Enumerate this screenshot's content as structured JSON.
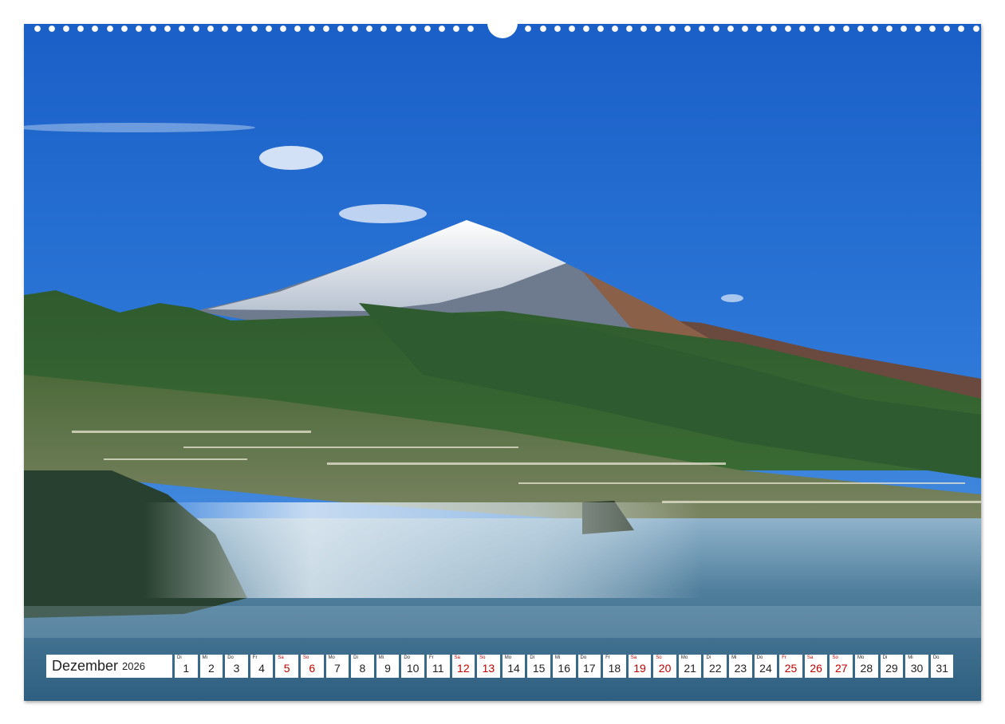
{
  "calendar": {
    "month": "Dezember",
    "year": "2026",
    "days": [
      {
        "wd": "Di",
        "num": "1",
        "red": false
      },
      {
        "wd": "Mi",
        "num": "2",
        "red": false
      },
      {
        "wd": "Do",
        "num": "3",
        "red": false
      },
      {
        "wd": "Fr",
        "num": "4",
        "red": false
      },
      {
        "wd": "Sa",
        "num": "5",
        "red": true
      },
      {
        "wd": "So",
        "num": "6",
        "red": true
      },
      {
        "wd": "Mo",
        "num": "7",
        "red": false
      },
      {
        "wd": "Di",
        "num": "8",
        "red": false
      },
      {
        "wd": "Mi",
        "num": "9",
        "red": false
      },
      {
        "wd": "Do",
        "num": "10",
        "red": false
      },
      {
        "wd": "Fr",
        "num": "11",
        "red": false
      },
      {
        "wd": "Sa",
        "num": "12",
        "red": true
      },
      {
        "wd": "So",
        "num": "13",
        "red": true
      },
      {
        "wd": "Mo",
        "num": "14",
        "red": false
      },
      {
        "wd": "Di",
        "num": "15",
        "red": false
      },
      {
        "wd": "Mi",
        "num": "16",
        "red": false
      },
      {
        "wd": "Do",
        "num": "17",
        "red": false
      },
      {
        "wd": "Fr",
        "num": "18",
        "red": false
      },
      {
        "wd": "Sa",
        "num": "19",
        "red": true
      },
      {
        "wd": "So",
        "num": "20",
        "red": true
      },
      {
        "wd": "Mo",
        "num": "21",
        "red": false
      },
      {
        "wd": "Di",
        "num": "22",
        "red": false
      },
      {
        "wd": "Mi",
        "num": "23",
        "red": false
      },
      {
        "wd": "Do",
        "num": "24",
        "red": false
      },
      {
        "wd": "Fr",
        "num": "25",
        "red": true
      },
      {
        "wd": "Sa",
        "num": "26",
        "red": true
      },
      {
        "wd": "So",
        "num": "27",
        "red": true
      },
      {
        "wd": "Mo",
        "num": "28",
        "red": false
      },
      {
        "wd": "Di",
        "num": "29",
        "red": false
      },
      {
        "wd": "Mi",
        "num": "30",
        "red": false
      },
      {
        "wd": "Do",
        "num": "31",
        "red": false
      }
    ]
  },
  "colors": {
    "weekend_red": "#c00000",
    "sky_top": "#1c62c9",
    "sky_bottom": "#4a8ee0",
    "sea": "#5d8aa8"
  },
  "photo": {
    "icon": "mountain-landscape"
  }
}
